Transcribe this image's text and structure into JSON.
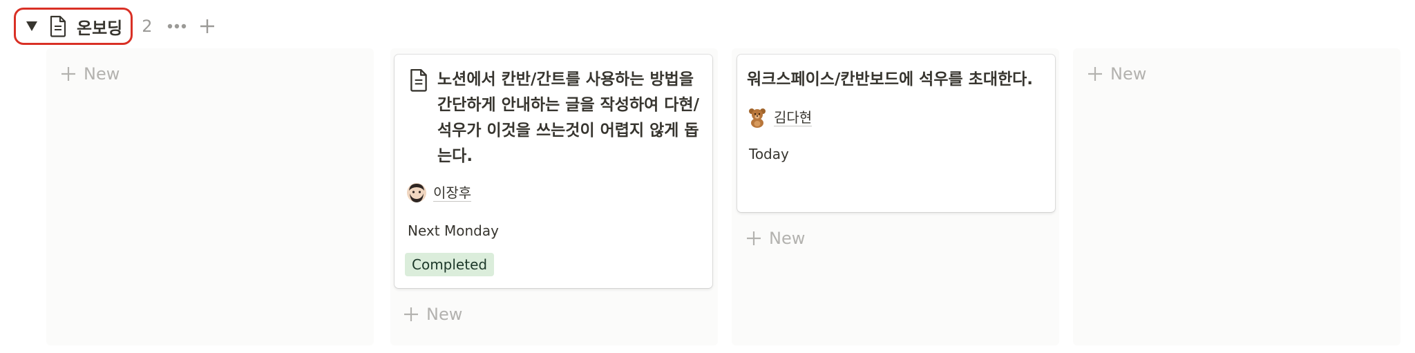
{
  "group": {
    "title": "온보딩",
    "count": "2"
  },
  "columns": [
    {
      "new_label": "New"
    },
    {
      "new_label": "New"
    },
    {
      "new_label": "New"
    },
    {
      "new_label": "New"
    }
  ],
  "cards": [
    {
      "title_lines": [
        "노션에서 칸반/간트를 사용하는 방법을",
        "간단하게 안내하는 글을 작성하여 다현/",
        "석우가 이것을 쓰는것이 어렵지 않게 돕",
        "는다."
      ],
      "assignee": "이장후",
      "date": "Next Monday",
      "status": "Completed",
      "icon": "page-icon",
      "avatar": "man-avatar"
    },
    {
      "title_lines": [
        "워크스페이스/칸반보드에 석우를 초대한다."
      ],
      "assignee": "김다현",
      "date": "Today",
      "avatar": "teddy-bear-avatar"
    }
  ],
  "colors": {
    "highlight_border": "#d93025",
    "status_green_bg": "#dbeddb",
    "status_green_text": "#1c3829",
    "muted_text": "#b3b2af",
    "column_bg": "#fbfbfa"
  }
}
